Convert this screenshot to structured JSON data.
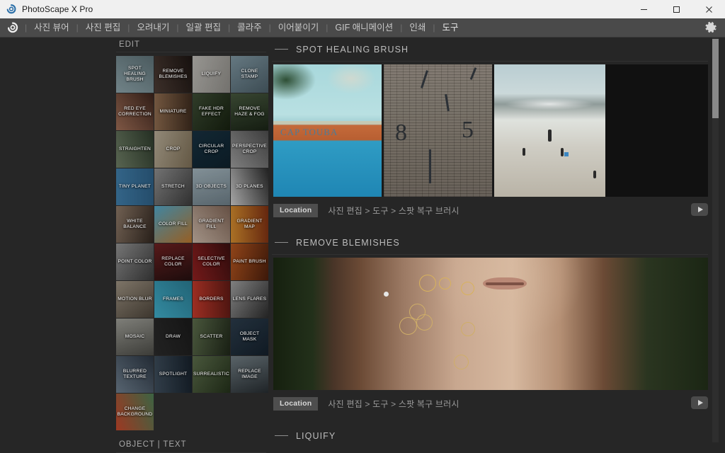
{
  "window": {
    "title": "PhotoScape X Pro",
    "logo_icon": "photoscape-logo-icon",
    "controls": [
      {
        "name": "minimize",
        "icon": "minimize-icon"
      },
      {
        "name": "maximize",
        "icon": "maximize-icon"
      },
      {
        "name": "close",
        "icon": "close-icon"
      }
    ]
  },
  "menubar": {
    "logo_icon": "app-logo-icon",
    "gear_icon": "gear-icon",
    "items": [
      {
        "label": "사진 뷰어",
        "active": false
      },
      {
        "label": "사진 편집",
        "active": false
      },
      {
        "label": "오려내기",
        "active": false
      },
      {
        "label": "일괄 편집",
        "active": false
      },
      {
        "label": "콜라주",
        "active": false
      },
      {
        "label": "이어붙이기",
        "active": false
      },
      {
        "label": "GIF 애니메이션",
        "active": false
      },
      {
        "label": "인쇄",
        "active": false
      },
      {
        "label": "도구",
        "active": true
      }
    ]
  },
  "sidebar": {
    "section_title": "EDIT",
    "footer_title": "OBJECT | TEXT",
    "tiles": [
      {
        "label": "SPOT HEALING BRUSH",
        "c1": "#8aa0a6",
        "c2": "#5c6f74"
      },
      {
        "label": "REMOVE BLEMISHES",
        "c1": "#4a3a33",
        "c2": "#1c1512"
      },
      {
        "label": "LIQUIFY",
        "c1": "#b9b7b2",
        "c2": "#8d8b86"
      },
      {
        "label": "CLONE STAMP",
        "c1": "#7c939e",
        "c2": "#4a5d66"
      },
      {
        "label": "RED EYE CORRECTION",
        "c1": "#9b6b54",
        "c2": "#3b241c"
      },
      {
        "label": "MINIATURE",
        "c1": "#8c6a4e",
        "c2": "#3d2b1e"
      },
      {
        "label": "FAKE HDR EFFECT",
        "c1": "#3b4a33",
        "c2": "#16200f"
      },
      {
        "label": "REMOVE HAZE & FOG",
        "c1": "#44553c",
        "c2": "#1a2416"
      },
      {
        "label": "STRAIGHTEN",
        "c1": "#6c7b63",
        "c2": "#2d3a2b"
      },
      {
        "label": "CROP",
        "c1": "#b3a893",
        "c2": "#7a6c54"
      },
      {
        "label": "CIRCULAR CROP",
        "c1": "#17303f",
        "c2": "#0e212c"
      },
      {
        "label": "PERSPECTIVE CROP",
        "c1": "#9a9a9a",
        "c2": "#4c4c4c"
      },
      {
        "label": "TINY PLANET",
        "c1": "#3f7ba6",
        "c2": "#2d5e83"
      },
      {
        "label": "STRETCH",
        "c1": "#8c8c8c",
        "c2": "#3b3b3b"
      },
      {
        "label": "3D OBJECTS",
        "c1": "#9fb0b8",
        "c2": "#6b7b84"
      },
      {
        "label": "3D PLANES",
        "c1": "#c9c9c9",
        "c2": "#2a2a2a"
      },
      {
        "label": "WHITE BALANCE",
        "c1": "#8a7665",
        "c2": "#30261f"
      },
      {
        "label": "COLOR FILL",
        "c1": "#4fa3c4",
        "c2": "#b8742c"
      },
      {
        "label": "GRADIENT FILL",
        "c1": "#c6b3a4",
        "c2": "#7d6354"
      },
      {
        "label": "GRADIENT MAP",
        "c1": "#d08a2e",
        "c2": "#7b2f12"
      },
      {
        "label": "POINT COLOR",
        "c1": "#8f8f8f",
        "c2": "#3a3a3a"
      },
      {
        "label": "REPLACE COLOR",
        "c1": "#6b2020",
        "c2": "#241010"
      },
      {
        "label": "SELECTIVE COLOR",
        "c1": "#8e2020",
        "c2": "#3a0f0f"
      },
      {
        "label": "PAINT BRUSH",
        "c1": "#b0541f",
        "c2": "#4a1e0c"
      },
      {
        "label": "MOTION BLUR",
        "c1": "#9a8f7f",
        "c2": "#4a4238"
      },
      {
        "label": "FRAMES",
        "c1": "#3fa9c4",
        "c2": "#2a7a90"
      },
      {
        "label": "BORDERS",
        "c1": "#c0392b",
        "c2": "#5e1a14"
      },
      {
        "label": "LENS FLARES",
        "c1": "#9c9c9c",
        "c2": "#2b2b2b"
      },
      {
        "label": "MOSAIC",
        "c1": "#9b9b94",
        "c2": "#4a4a45"
      },
      {
        "label": "DRAW",
        "c1": "#2a2a2a",
        "c2": "#1a1a1a"
      },
      {
        "label": "SCATTER",
        "c1": "#5a6a4a",
        "c2": "#1e2618"
      },
      {
        "label": "OBJECT MASK",
        "c1": "#2b3b4a",
        "c2": "#14202b"
      },
      {
        "label": "BLURRED TEXTURE",
        "c1": "#6b7b8a",
        "c2": "#2a3440"
      },
      {
        "label": "SPOTLIGHT",
        "c1": "#3d4c5a",
        "c2": "#16202a"
      },
      {
        "label": "SURREALISTIC",
        "c1": "#5a6b4a",
        "c2": "#23301a"
      },
      {
        "label": "REPLACE IMAGE",
        "c1": "#6e7a80",
        "c2": "#262c30"
      },
      {
        "label": "CHANGE BACKGROUND",
        "c1": "#c0452a",
        "c2": "#4a7a52"
      }
    ]
  },
  "content": {
    "location_label": "Location",
    "play_icon": "play-icon",
    "sections": [
      {
        "title": "SPOT HEALING BRUSH",
        "breadcrumb": "사진 편집 > 도구 > 스팟 복구 브러시",
        "preview": "pool-wall-beach-triptych"
      },
      {
        "title": "REMOVE BLEMISHES",
        "breadcrumb": "사진 편집 > 도구 > 스팟 복구 브러시",
        "preview": "portrait-with-blemish-circles"
      },
      {
        "title": "LIQUIFY",
        "breadcrumb": "",
        "preview": ""
      }
    ]
  },
  "colors": {
    "app_bg": "#262626",
    "menubar_bg": "#4a4a4a",
    "titlebar_bg": "#f0f0f0",
    "accent_blue": "#3f7ba6",
    "text_muted": "#9a9a9a"
  }
}
